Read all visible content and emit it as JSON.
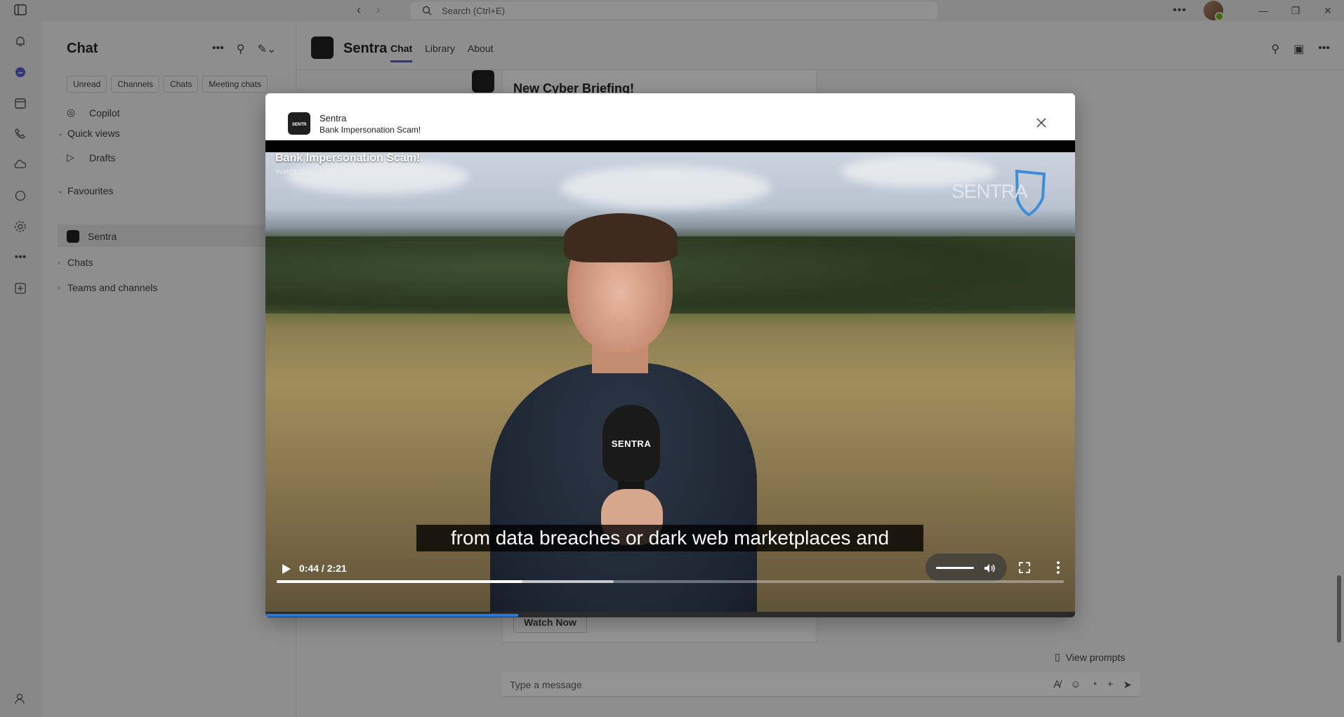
{
  "titlebar": {
    "search_placeholder": "Search (Ctrl+E)"
  },
  "chat_panel": {
    "title": "Chat",
    "filters": [
      "Unread",
      "Channels",
      "Chats",
      "Meeting chats"
    ],
    "copilot_label": "Copilot",
    "quick_views_label": "Quick views",
    "drafts_label": "Drafts",
    "favourites_label": "Favourites",
    "favourite_item": "Sentra",
    "chats_label": "Chats",
    "teams_label": "Teams and channels"
  },
  "channel": {
    "name": "Sentra",
    "tabs": [
      "Chat",
      "Library",
      "About"
    ],
    "active_tab": "Chat"
  },
  "post": {
    "title": "New Cyber Briefing!",
    "button_label": "Watch Now"
  },
  "composer": {
    "view_prompts": "View prompts",
    "placeholder": "Type a message"
  },
  "modal": {
    "app_name": "Sentra",
    "subtitle": "Bank Impersonation Scam!"
  },
  "video": {
    "title": "Bank Impersonation Scam!",
    "watch_label": "Watch...",
    "logo_text": "SENTRA",
    "mic_logo_text": "SENTRA",
    "caption": "from data breaches or dark web marketplaces and",
    "time_display": "0:44 / 2:21",
    "current_seconds": 44,
    "duration_seconds": 141,
    "buffered_fraction": 0.29,
    "volume_fraction": 1.0,
    "accent_color": "#2b7ad6"
  }
}
